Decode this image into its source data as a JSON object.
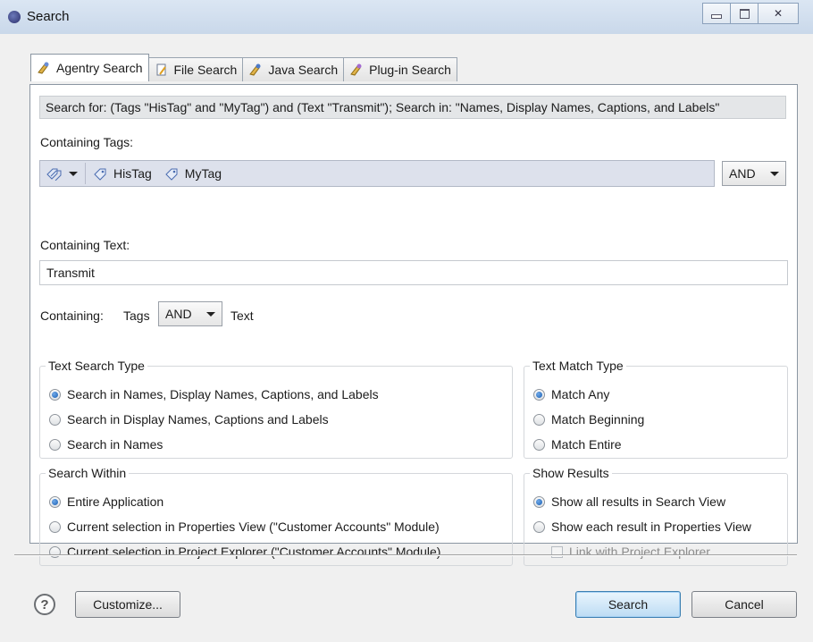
{
  "window": {
    "title": "Search"
  },
  "tabs": [
    {
      "label": "Agentry Search",
      "icon": "agentry-search-icon",
      "active": true
    },
    {
      "label": "File Search",
      "icon": "file-search-icon",
      "active": false
    },
    {
      "label": "Java Search",
      "icon": "java-search-icon",
      "active": false
    },
    {
      "label": "Plug-in Search",
      "icon": "plugin-search-icon",
      "active": false
    }
  ],
  "summary": "Search for: (Tags \"HisTag\" and \"MyTag\") and (Text \"Transmit\");  Search in: \"Names, Display Names, Captions, and Labels\"",
  "containing_tags": {
    "label": "Containing Tags:",
    "tags": [
      "HisTag",
      "MyTag"
    ],
    "operator": "AND"
  },
  "containing_text": {
    "label": "Containing Text:",
    "value": "Transmit"
  },
  "containing": {
    "prefix": "Containing:",
    "left": "Tags",
    "operator": "AND",
    "right": "Text"
  },
  "text_search_type": {
    "legend": "Text Search Type",
    "options": [
      {
        "label": "Search in Names, Display Names, Captions, and Labels",
        "selected": true
      },
      {
        "label": "Search in Display Names, Captions and Labels",
        "selected": false
      },
      {
        "label": "Search in Names",
        "selected": false
      }
    ]
  },
  "text_match_type": {
    "legend": "Text Match Type",
    "options": [
      {
        "label": "Match Any",
        "selected": true
      },
      {
        "label": "Match Beginning",
        "selected": false
      },
      {
        "label": "Match Entire",
        "selected": false
      }
    ]
  },
  "search_within": {
    "legend": "Search Within",
    "options": [
      {
        "label": "Entire Application",
        "selected": true
      },
      {
        "label": "Current selection in Properties View (\"Customer Accounts\" Module)",
        "selected": false
      },
      {
        "label": "Current selection in Project Explorer (\"Customer Accounts\" Module)",
        "selected": false
      }
    ]
  },
  "show_results": {
    "legend": "Show Results",
    "options": [
      {
        "label": "Show all results in Search View",
        "selected": true
      },
      {
        "label": "Show each result in Properties View",
        "selected": false
      }
    ],
    "link_checkbox": {
      "label": "Link with Project Explorer",
      "checked": false,
      "disabled": true
    }
  },
  "footer": {
    "help": "?",
    "customize": "Customize...",
    "search": "Search",
    "cancel": "Cancel"
  }
}
